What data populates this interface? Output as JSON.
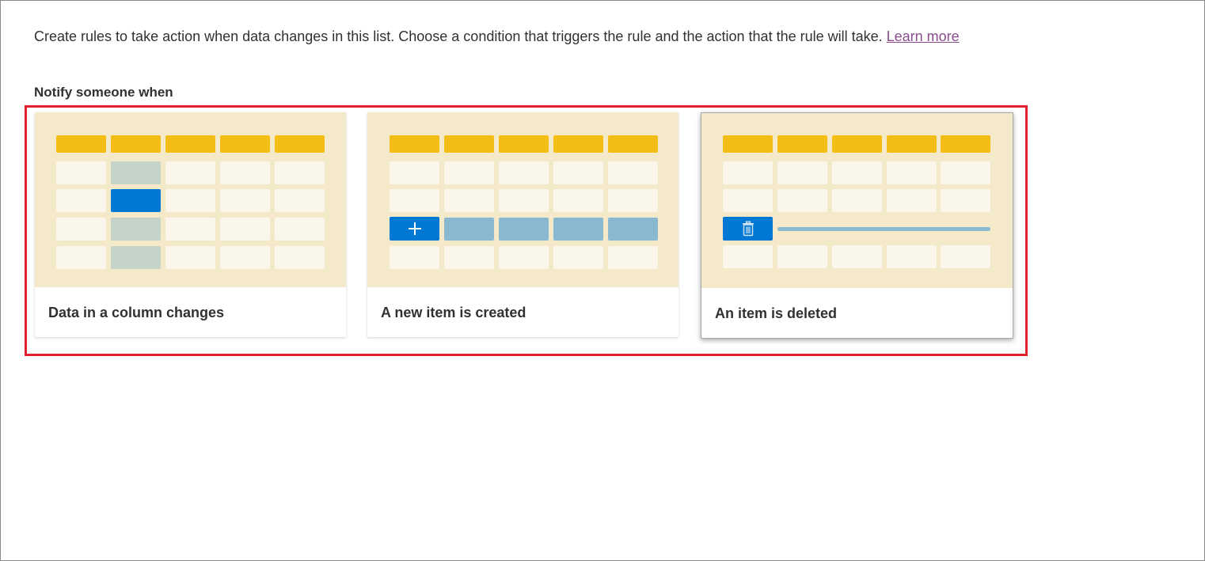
{
  "intro": {
    "text": "Create rules to take action when data changes in this list. Choose a condition that triggers the rule and the action that the rule will take. ",
    "link": "Learn more"
  },
  "section": {
    "heading": "Notify someone when"
  },
  "cards": [
    {
      "label": "Data in a column changes",
      "icon": "column-change-illustration"
    },
    {
      "label": "A new item is created",
      "icon": "plus-icon"
    },
    {
      "label": "An item is deleted",
      "icon": "trash-icon"
    }
  ],
  "colors": {
    "header_cell": "#f3bd16",
    "illustration_bg": "#f4e9c8",
    "accent_blue": "#0078d4",
    "highlight_border": "#e0202e",
    "link": "#8a4c8f"
  }
}
